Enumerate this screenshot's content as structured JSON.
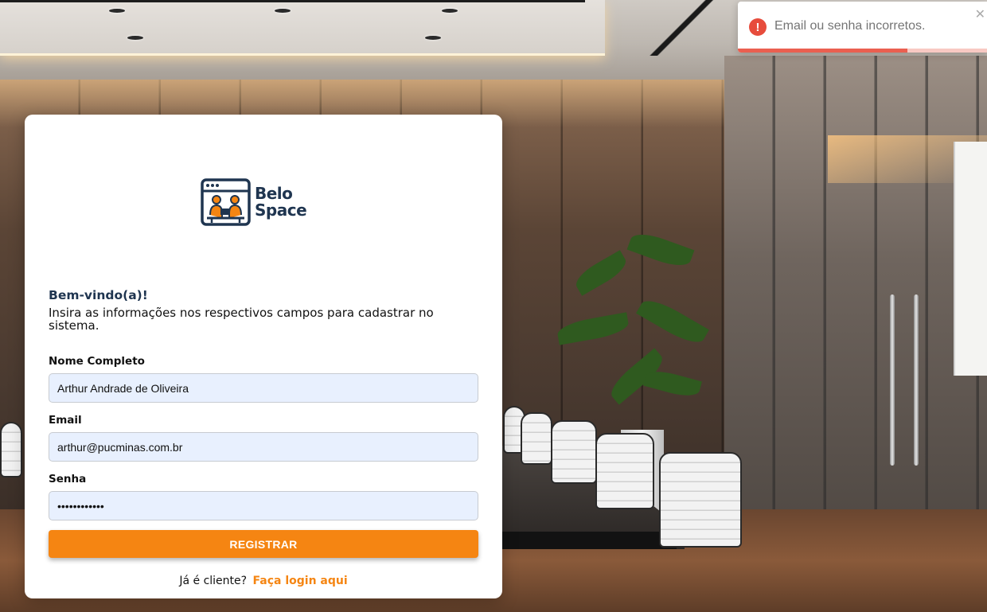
{
  "brand": {
    "line1": "Belo",
    "line2": "Space"
  },
  "form": {
    "welcome": "Bem-vindo(a)!",
    "intro": "Insira as informações nos respectivos campos para cadastrar no sistema.",
    "name_label": "Nome Completo",
    "name_value": "Arthur Andrade de Oliveira",
    "email_label": "Email",
    "email_value": "arthur@pucminas.com.br",
    "password_label": "Senha",
    "password_value": "••••••••••••",
    "submit_label": "REGISTRAR",
    "login_prompt": "Já é cliente?",
    "login_link": "Faça login aqui"
  },
  "toast": {
    "icon": "error-icon",
    "message": "Email ou senha incorretos.",
    "close_glyph": "✕",
    "progress_remaining": 0.68
  },
  "colors": {
    "accent": "#f58512",
    "brand_navy": "#1f3550",
    "error": "#e74c3c",
    "input_bg": "#e8f0fe"
  }
}
